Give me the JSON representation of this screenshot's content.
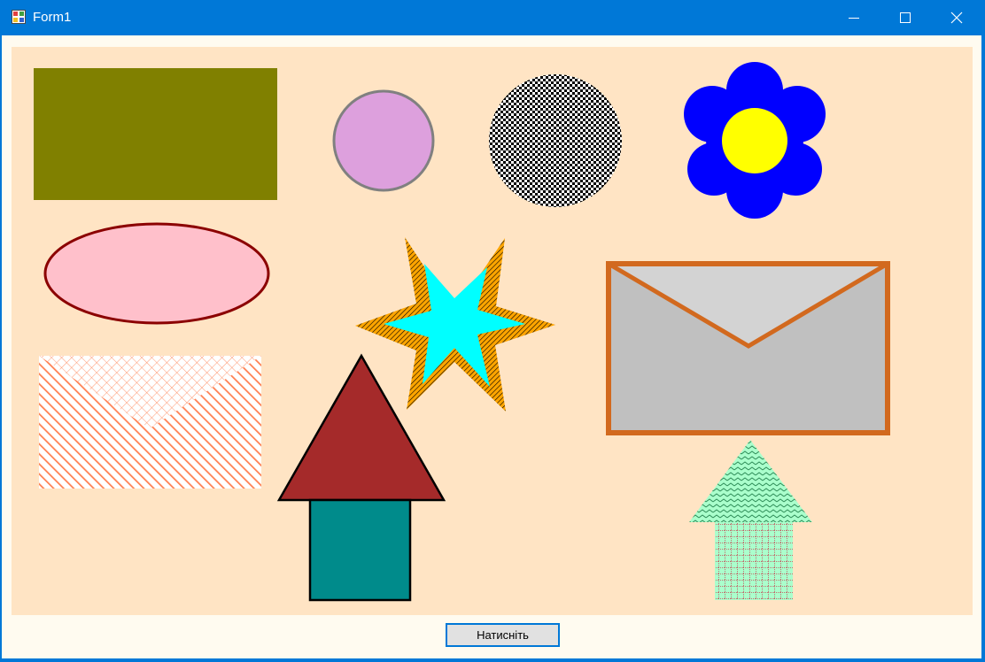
{
  "window": {
    "title": "Form1",
    "app_icon": "winforms-app-icon",
    "controls": {
      "minimize_icon": "minimize-icon",
      "maximize_icon": "maximize-icon",
      "close_icon": "close-icon"
    }
  },
  "canvas": {
    "background": "#ffe4c4"
  },
  "colors": {
    "olive_rect": "#808000",
    "plum_circle": "#dda0dd",
    "circle_outline": "#808080",
    "flower_petals": "#0000ff",
    "flower_center": "#ffff00",
    "pink_ellipse": "#ffc0cb",
    "ellipse_outline": "#8b0000",
    "star_fill": "#00ffff",
    "star_hatch": "#ffa500",
    "envelope_fill": "#c0c0c0",
    "envelope_flap": "#d3d3d3",
    "envelope_outline": "#d2691e",
    "hatched_envelope": "#ff7f50",
    "house_roof": "#a52a2a",
    "house_body": "#008b8b",
    "arrow_pattern": "#2e8b57",
    "arrow_fill": "#aaffcc"
  },
  "button": {
    "label": "Натисніть"
  }
}
